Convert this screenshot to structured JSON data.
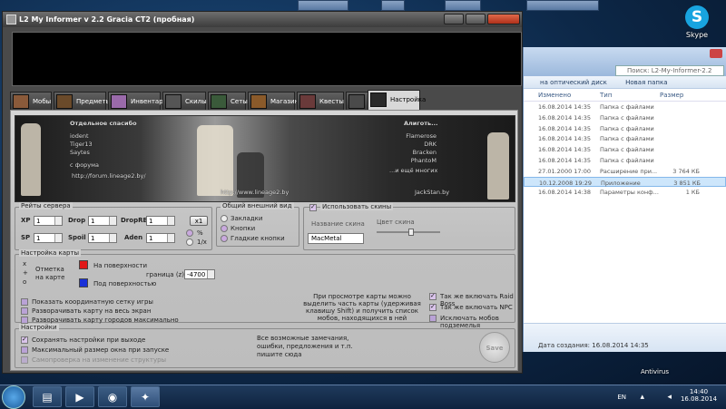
{
  "app": {
    "title": "L2 My Informer v 2.2 Gracia CT2 (пробная)",
    "tabs": [
      "Мобы",
      "Предметы",
      "Инвентарь",
      "Скилы",
      "Сеты",
      "Магазин",
      "Квесты",
      "IC",
      "Настройка"
    ],
    "active_tab": "Настройка"
  },
  "banner": {
    "thanks_title": "Отдельное спасибо",
    "names_left": [
      "iodent",
      "Tiger13",
      "Saytes"
    ],
    "site_pre": "с форума",
    "site1": "http://forum.lineage2.by/",
    "names_right_title": "Алиготь...",
    "names_right": [
      "Flamerose",
      "DRK",
      "Bracken",
      "PhantoM"
    ],
    "names_right_footer": "...и ещё многих",
    "site2": "http://www.lineage2.by",
    "author": "JackStan.by"
  },
  "rates": {
    "title": "Рейты сервера",
    "xp_label": "XP",
    "xp_value": "1",
    "sp_label": "SP",
    "sp_value": "1",
    "drop_label": "Drop",
    "drop_value": "1",
    "spoil_label": "Spoil",
    "spoil_value": "1",
    "droprb_label": "DropRB",
    "droprb_value": "1",
    "aden_label": "Aden",
    "aden_value": "1",
    "x1_button": "x1",
    "percent_label": "%",
    "onex_label": "1/x"
  },
  "look": {
    "title": "Общий внешний вид",
    "bookmarks": "Закладки",
    "buttons": "Кнопки",
    "smooth": "Гладкие кнопки"
  },
  "skins": {
    "use_skins": "Использовать скины",
    "skin_name_label": "Название скина",
    "skin_color_label": "Цвет скина",
    "skin_value": "MacMetal"
  },
  "map": {
    "title": "Настройка карты",
    "marker_x": "x",
    "marker_plus": "+",
    "marker_o": "o",
    "mark_on_map": "Отметка на карте",
    "on_surface": "На поверхности",
    "under_surface": "Под поверхностью",
    "border_label": "граница (z)",
    "border_value": "-4700",
    "show_grid": "Показать координатную сетку игры",
    "expand_map": "Разворачивать карту на весь экран",
    "expand_cities": "Разворачивать карту городов максимально",
    "hint": "При просмотре карты можно выделить часть карты (удерживая клавишу Shift) и получить список мобов, находящихся в ней",
    "include_raidboss": "Так же включать Raid Boss",
    "include_npc": "Так же включать NPC",
    "exclude_dungeons": "Исключать мобов подземелья"
  },
  "settings": {
    "title": "Настройки",
    "save_on_exit": "Сохранять настройки при выходе",
    "max_window": "Максимальный размер окна при запуске",
    "self_check": "Самопроверка на изменение структуры",
    "feedback": "Все возможные замечания, ошибки, предложения и т.п. пишите сюда",
    "save_button": "Save"
  },
  "explorer": {
    "search": "Поиск: L2-My-Informer-2.2",
    "toolbar": [
      "на оптический диск",
      "Новая папка"
    ],
    "headers": [
      "Изменено",
      "Тип",
      "Размер"
    ],
    "rows": [
      {
        "date": "16.08.2014 14:35",
        "type": "Папка с файлами",
        "size": ""
      },
      {
        "date": "16.08.2014 14:35",
        "type": "Папка с файлами",
        "size": ""
      },
      {
        "date": "16.08.2014 14:35",
        "type": "Папка с файлами",
        "size": ""
      },
      {
        "date": "16.08.2014 14:35",
        "type": "Папка с файлами",
        "size": ""
      },
      {
        "date": "16.08.2014 14:35",
        "type": "Папка с файлами",
        "size": ""
      },
      {
        "date": "16.08.2014 14:35",
        "type": "Папка с файлами",
        "size": ""
      },
      {
        "date": "27.01.2000 17:00",
        "type": "Расширение при...",
        "size": "3 764 КБ"
      },
      {
        "date": "10.12.2008 19:29",
        "type": "Приложение",
        "size": "3 851 КБ"
      },
      {
        "date": "16.08.2014 14:38",
        "type": "Параметры конф...",
        "size": "1 КБ"
      }
    ],
    "status": "Дата создания: 16.08.2014 14:35"
  },
  "desktop": {
    "skype_label": "Skype",
    "antivirus_label": "Antivirus"
  },
  "taskbar": {
    "lang": "EN",
    "time": "14:40",
    "date": "16.08.2014"
  },
  "colors": {
    "on_surface": "#e01818",
    "under_surface": "#1830d8",
    "accent": "#b9a2d6"
  }
}
